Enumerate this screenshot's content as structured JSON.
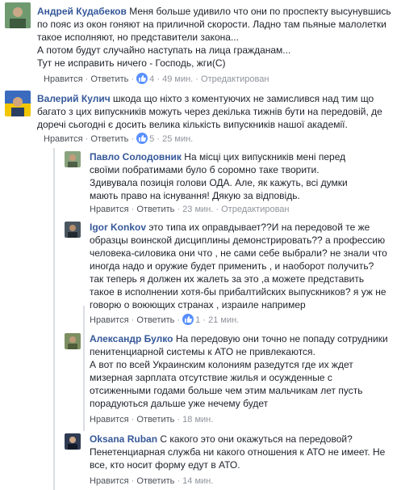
{
  "actions": {
    "like": "Нравится",
    "reply": "Ответить",
    "edited": "Отредактирован",
    "sep": "·"
  },
  "comments": [
    {
      "author": "Андрей Кудабеков",
      "text": "Меня больше удивило что они по проспекту высунувшись по пояс из окон гоняют на приличной скорости. Ладно там пьяные малолетки такое исполняют, но представители закона...\nА потом будут случайно наступать на лица гражданам...\nТут не исправить ничего - Господь, жги(С)",
      "likes": "4",
      "time": "49 мин.",
      "edited": true
    },
    {
      "author": "Валерий Кулич",
      "text": "шкода що ніхто з коментуючих не замислився над тим що багато з цих випускників можуть через декілька тижнів бути на передовій, де доречі сьогодні є досить велика кількість випускників нашої академії.",
      "likes": "5",
      "time": "25 мин."
    },
    {
      "author": "Павло Солодовник",
      "text": "На місці цих випускників мені перед своїми побратимами було б соромно таке творити. Здивувала позиція голови ОДА. Але, як кажуть, всі думки мають право на існування! Дякую за відповідь.",
      "time": "23 мин.",
      "edited": true
    },
    {
      "author": "Igor Konkov",
      "text": "это типа их оправдывает??И на передовой те же образцы воинской дисциплины демонстрировать?? а професcию человека-силовика они что , не сами себе выбрали? не знали что иногда надо и оружие будет применить , и наоборот получить? так теперь я должен их жалеть за это ,а можете представить такое в исполнении хотя-бы прибалтийских выпускников? я уж не говорю о воюющих странах , израиле например",
      "likes": "1",
      "time": "21 мин."
    },
    {
      "author": "Александр Булко",
      "text": "На передовую они точно не попаду сотрудники пенитенциарной системы к АТО не привлекаются.\nА вот по всей Украинским колониям разедутся где их ждет мизерная зарплата отсутствие жилья и осужденные с отсиженными годами больше чем этим мальчикам лет пусть порадуються дальше уже нечему будет",
      "time": "18 мин."
    },
    {
      "author": "Oksana Ruban",
      "text": "С какого это они окажуться на передовой? Пенетенциарная служба ни какого отношения к АТО не имеет. Не все, кто носит форму едут в АТО.",
      "time": "14 мин."
    }
  ]
}
